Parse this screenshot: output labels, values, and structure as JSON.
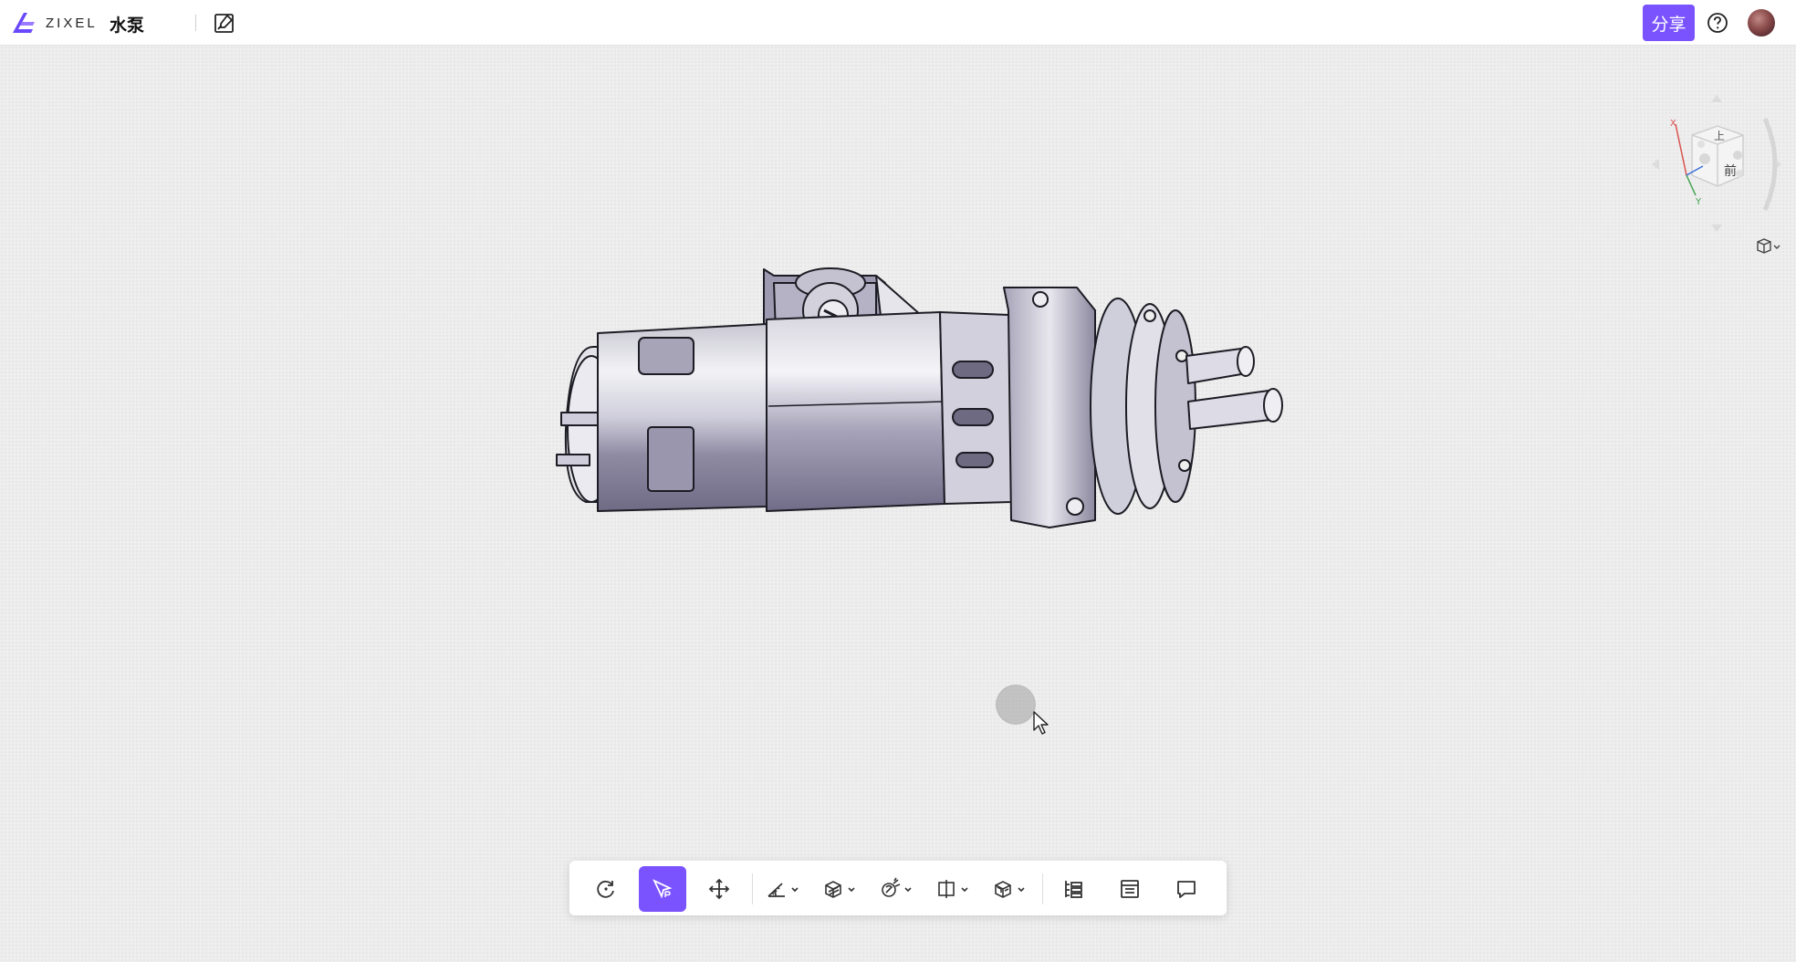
{
  "app": {
    "logo_text": "ZIXEL",
    "document_title": "水泵"
  },
  "header": {
    "share_label": "分享",
    "help_icon": "question-circle-icon",
    "edit_icon": "edit-image-icon"
  },
  "navcube": {
    "axes": {
      "x_label": "X",
      "y_label": "Y"
    },
    "faces": {
      "top_label": "上",
      "front_label": "前"
    },
    "colors": {
      "x_axis": "#d9534f",
      "y_axis": "#3fa34d",
      "z_axis": "#3b6fd9"
    }
  },
  "toolbar": {
    "tools": [
      {
        "name": "rotate",
        "icon": "rotate-icon",
        "active": false,
        "has_dropdown": false
      },
      {
        "name": "select",
        "icon": "select-cursor-icon",
        "active": true,
        "has_dropdown": false
      },
      {
        "name": "pan",
        "icon": "move-arrows-icon",
        "active": false,
        "has_dropdown": false
      },
      {
        "name": "measure",
        "icon": "ruler-angle-icon",
        "active": false,
        "has_dropdown": true
      },
      {
        "name": "section",
        "icon": "section-cube-icon",
        "active": false,
        "has_dropdown": true
      },
      {
        "name": "explode",
        "icon": "explode-view-icon",
        "active": false,
        "has_dropdown": true
      },
      {
        "name": "display",
        "icon": "display-mode-icon",
        "active": false,
        "has_dropdown": true
      },
      {
        "name": "render",
        "icon": "render-cube-icon",
        "active": false,
        "has_dropdown": true
      },
      {
        "name": "model-tree",
        "icon": "tree-list-icon",
        "active": false,
        "has_dropdown": false
      },
      {
        "name": "properties",
        "icon": "properties-list-icon",
        "active": false,
        "has_dropdown": false
      },
      {
        "name": "comments",
        "icon": "comment-bubble-icon",
        "active": false,
        "has_dropdown": false
      }
    ]
  },
  "theme": {
    "accent": "#7a53ff",
    "viewport_bg": "#eeeeee",
    "model_fill": "#9a96ad",
    "model_light": "#dcdbe3"
  }
}
